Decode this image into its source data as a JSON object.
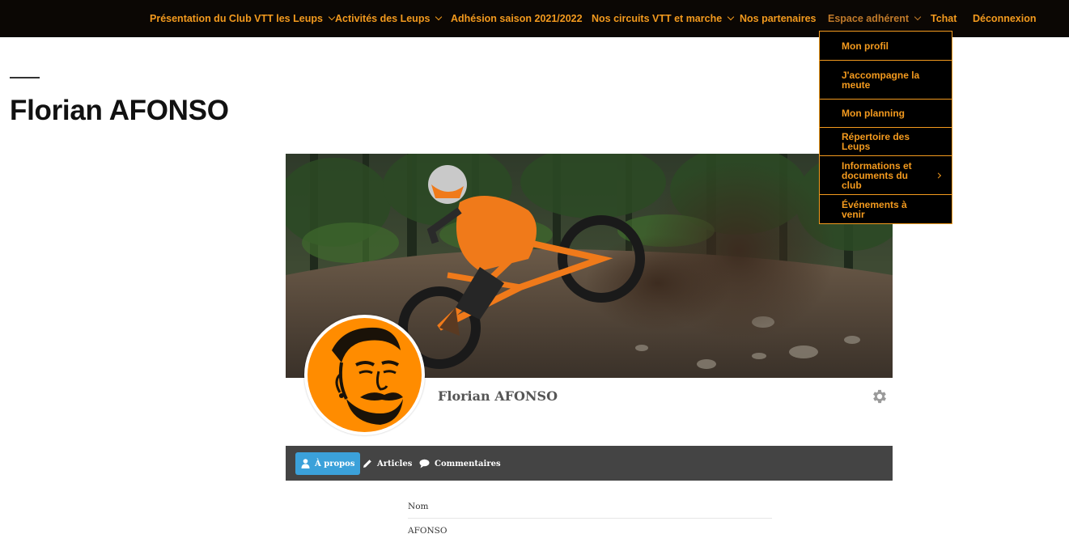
{
  "nav": {
    "items": [
      {
        "label": "Présentation du Club VTT les Leups"
      },
      {
        "label": "Activités des Leups"
      },
      {
        "label": "Adhésion saison 2021/2022"
      },
      {
        "label": "Nos circuits VTT et marche"
      },
      {
        "label": "Nos partenaires"
      },
      {
        "label": "Espace adhérent"
      },
      {
        "label": "Tchat"
      },
      {
        "label": "Déconnexion"
      }
    ],
    "accent_color": "#f39a1e",
    "background_color": "#0b0704"
  },
  "dropdown": {
    "items": [
      {
        "label": "Mon profil"
      },
      {
        "label": "J'accompagne la meute"
      },
      {
        "label": "Mon planning"
      },
      {
        "label": "Répertoire des Leups"
      },
      {
        "label": "Informations et documents du club"
      },
      {
        "label": "Événements à venir"
      }
    ]
  },
  "page": {
    "title": "Florian AFONSO"
  },
  "profile": {
    "name": "Florian AFONSO",
    "cover_icon": "mountain-bike-rider-photo",
    "avatar_icon": "bearded-man-illustration",
    "settings_icon": "gear-icon"
  },
  "tabs": [
    {
      "label": "À propos",
      "icon": "user-icon"
    },
    {
      "label": "Articles",
      "icon": "pencil-icon"
    },
    {
      "label": "Commentaires",
      "icon": "comment-icon"
    }
  ],
  "fields": [
    {
      "label": "Nom",
      "value": "AFONSO"
    }
  ],
  "colors": {
    "tab_bar": "#444444",
    "active_tab": "#3ba1da",
    "avatar_background": "#ff8c00"
  }
}
